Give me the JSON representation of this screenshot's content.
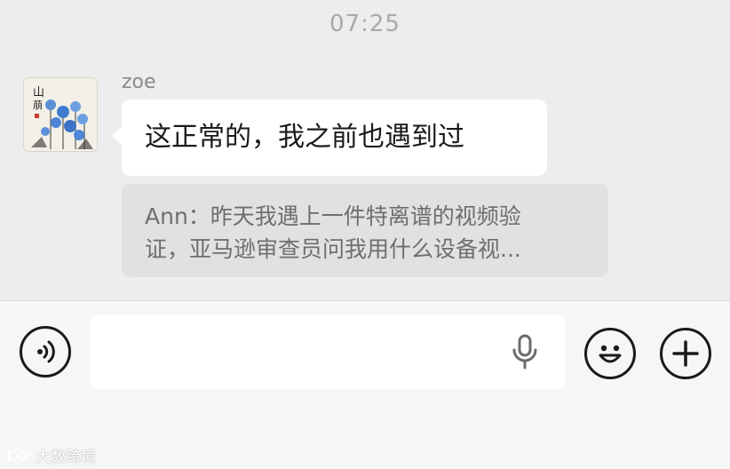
{
  "chat": {
    "time": "07:25",
    "sender_name": "zoe",
    "message": "这正常的，我之前也遇到过",
    "quote": {
      "line1": "Ann：昨天我遇上一件特离谱的视频验",
      "line2": "证，亚马逊审查员问我用什么设备视..."
    }
  },
  "input_bar": {
    "voice_icon": "voice-wave-icon",
    "mic_icon": "microphone-icon",
    "emoji_icon": "smiley-emoji-icon",
    "plus_icon": "plus-icon"
  },
  "watermark": {
    "text": "大数跨境"
  },
  "colors": {
    "background": "#ededed",
    "bubble": "#ffffff",
    "quote_bg": "#e1e1e1",
    "input_bar_bg": "#f6f6f6"
  }
}
